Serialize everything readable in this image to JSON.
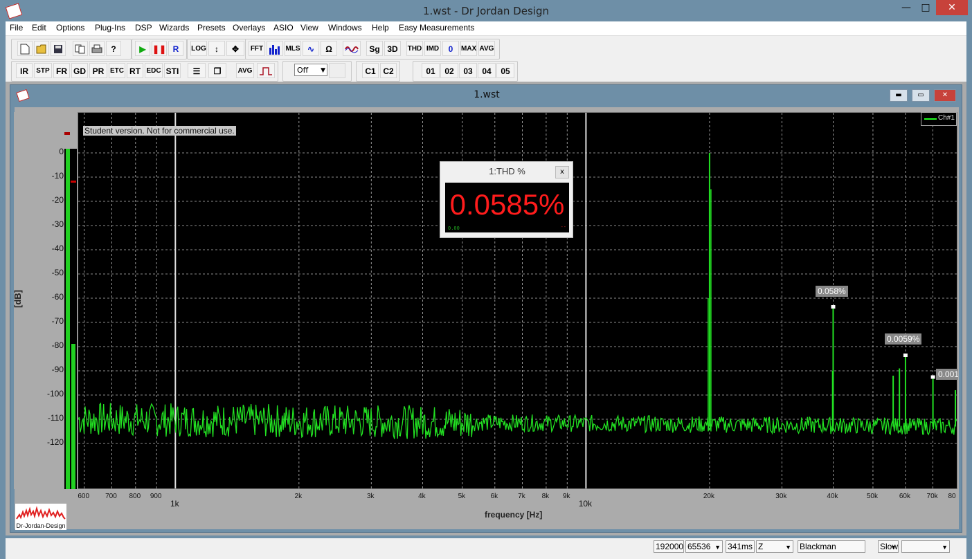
{
  "window": {
    "title": "1.wst - Dr Jordan Design",
    "min_glyph": "—",
    "max_glyph": "□",
    "close_glyph": "✕"
  },
  "menu": [
    "File",
    "Edit",
    "Options",
    "Plug-Ins",
    "DSP",
    "Wizards",
    "Presets",
    "Overlays",
    "ASIO",
    "View",
    "Windows",
    "Help",
    "Easy Measurements"
  ],
  "toolbar1": {
    "buttons": [
      "LOG",
      "FFT",
      "MLS",
      "Sg",
      "3D",
      "THD",
      "IMD",
      "0",
      "MAX",
      "AVG"
    ]
  },
  "toolbar2": {
    "buttons": [
      "IR",
      "STP",
      "FR",
      "GD",
      "PR",
      "ETC",
      "RT",
      "EDC",
      "STI",
      "AVG"
    ],
    "off_select": "Off",
    "channels": [
      "C1",
      "C2"
    ],
    "overlays": [
      "01",
      "02",
      "03",
      "04",
      "05"
    ]
  },
  "child": {
    "title": "1.wst",
    "min_glyph": "▬",
    "max_glyph": "▭",
    "close_glyph": "✕"
  },
  "plot": {
    "student_note": "Student version. Not for commercial use.",
    "legend": "Ch#1",
    "xaxis_title": "frequency [Hz]",
    "yaxis_title": "[dB]",
    "annotations": [
      "0.058%",
      "0.0059%",
      "0.001"
    ]
  },
  "thd_panel": {
    "title": "1:THD %",
    "value": "0.0585%",
    "close": "x",
    "small_left": "0.00",
    "small_right": "--"
  },
  "logo": {
    "text": "Dr-Jordan-Design"
  },
  "chart_data": {
    "type": "line",
    "xscale": "log",
    "xlim": [
      580,
      80000
    ],
    "ylim": [
      -130,
      0
    ],
    "y_ticks": [
      "0",
      "-10",
      "-20",
      "-30",
      "-40",
      "-50",
      "-60",
      "-70",
      "-80",
      "-90",
      "-100",
      "-110",
      "-120"
    ],
    "x_ticks_small": [
      "600",
      "700",
      "800",
      "900",
      "2k",
      "3k",
      "4k",
      "5k",
      "6k",
      "7k",
      "8k",
      "9k",
      "20k",
      "30k",
      "40k",
      "50k",
      "60k",
      "70k",
      "80"
    ],
    "x_ticks_major": [
      "1k",
      "10k"
    ],
    "ylabel": "[dB]",
    "xlabel": "frequency [Hz]",
    "series": [
      {
        "name": "Ch#1",
        "color": "#22e022",
        "noise_floor_db": -113,
        "peaks": [
          {
            "x": 20000,
            "y": 0
          },
          {
            "x": 40000,
            "y": -64
          },
          {
            "x": 60000,
            "y": -84
          },
          {
            "x": 56000,
            "y": -92
          },
          {
            "x": 58000,
            "y": -89
          },
          {
            "x": 70000,
            "y": -93
          },
          {
            "x": 80000,
            "y": -98
          }
        ]
      }
    ],
    "grid": true,
    "legend": "top-right"
  },
  "meter": {
    "level_db": -79,
    "peak_marker_db": -12
  },
  "statusbar": {
    "fields": [
      "192000",
      "65536",
      "341ms",
      "Z",
      "Blackman",
      "Slow",
      ""
    ]
  }
}
